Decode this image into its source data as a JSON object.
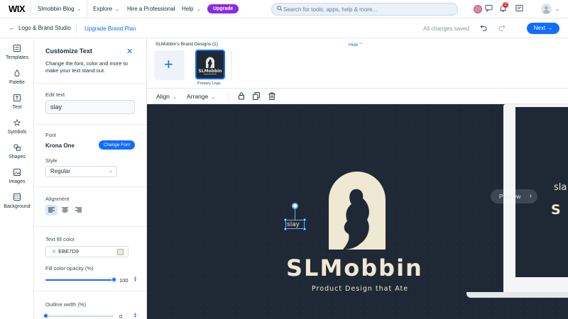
{
  "topbar": {
    "logo": "WIX",
    "site_name": "Slmobbin Blog",
    "explore": "Explore",
    "hire": "Hire a Professional",
    "help": "Help",
    "upgrade": "Upgrade",
    "search_placeholder": "Search for tools, apps, help & more...",
    "notifications_count": "2"
  },
  "subbar": {
    "back_label": "Logo & Brand Studio",
    "upgrade_plan": "Upgrade Brand Plan",
    "save_status": "All changes saved",
    "next": "Next"
  },
  "rail": {
    "items": [
      {
        "label": "Templates",
        "icon": "templates-icon"
      },
      {
        "label": "Palette",
        "icon": "palette-icon"
      },
      {
        "label": "Text",
        "icon": "text-icon"
      },
      {
        "label": "Symbols",
        "icon": "symbols-icon"
      },
      {
        "label": "Shapes",
        "icon": "shapes-icon"
      },
      {
        "label": "Images",
        "icon": "images-icon"
      },
      {
        "label": "Background",
        "icon": "background-icon"
      }
    ]
  },
  "panel": {
    "title": "Customize Text",
    "description": "Change the font, color and more to make your text stand out.",
    "edit_text_label": "Edit text",
    "edit_text_value": "slay",
    "font_label": "Font",
    "font_name": "Krona One",
    "change_font": "Change Font",
    "style_label": "Style",
    "style_value": "Regular",
    "alignment_label": "Alignment",
    "fill_color_label": "Text fill color",
    "fill_color_hash": "#",
    "fill_color_value": "EBE7D9",
    "opacity_label": "Fill color opacity (%)",
    "opacity_value": "100",
    "opacity_fraction": 1.0,
    "outline_label": "Outline width (%)",
    "outline_value": "0",
    "outline_fraction": 0.0
  },
  "strip": {
    "title": "SLMobbin's Brand Designs (1)",
    "hide": "Hide",
    "tile_caption": "Primary Logo"
  },
  "toolbar": {
    "align": "Align",
    "arrange": "Arrange"
  },
  "canvas": {
    "brand_name": "SLMobbin",
    "tagline": "Product Design that Ate",
    "selected_text": "slay",
    "preview": "Preview",
    "mini_text_1": "sla",
    "mini_text_2": "S"
  },
  "colors": {
    "accent": "#116dff",
    "canvas_bg": "#1e2935",
    "logo_cream": "#ebe7d9",
    "upgrade_purple": "#8a2be2"
  }
}
